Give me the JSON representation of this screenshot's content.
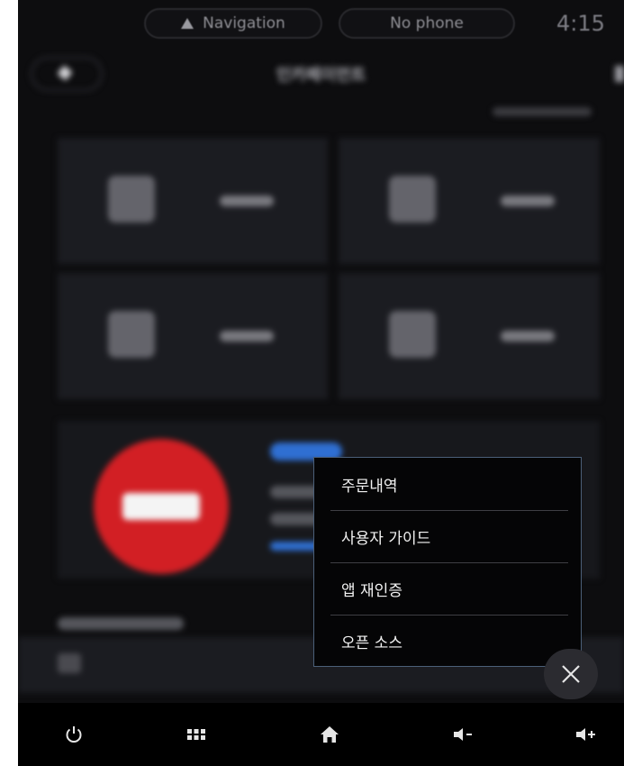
{
  "status_bar": {
    "navigation_label": "Navigation",
    "phone_label": "No phone",
    "clock": "4:15"
  },
  "app": {
    "title": "인카페이먼트"
  },
  "context_menu": {
    "items": [
      {
        "label": "주문내역"
      },
      {
        "label": "사용자 가이드"
      },
      {
        "label": "앱 재인증"
      },
      {
        "label": "오픈 소스"
      }
    ]
  },
  "bottom_bar": {
    "buttons": [
      {
        "icon": "power-icon"
      },
      {
        "icon": "apps-grid-icon"
      },
      {
        "icon": "home-icon"
      },
      {
        "icon": "volume-down-icon"
      },
      {
        "icon": "volume-up-icon"
      }
    ]
  },
  "colors": {
    "background": "#0d0d0f",
    "menu_border": "#4b5f78",
    "promo_logo": "#d21f24",
    "badge_blue": "#2f6fd2"
  }
}
